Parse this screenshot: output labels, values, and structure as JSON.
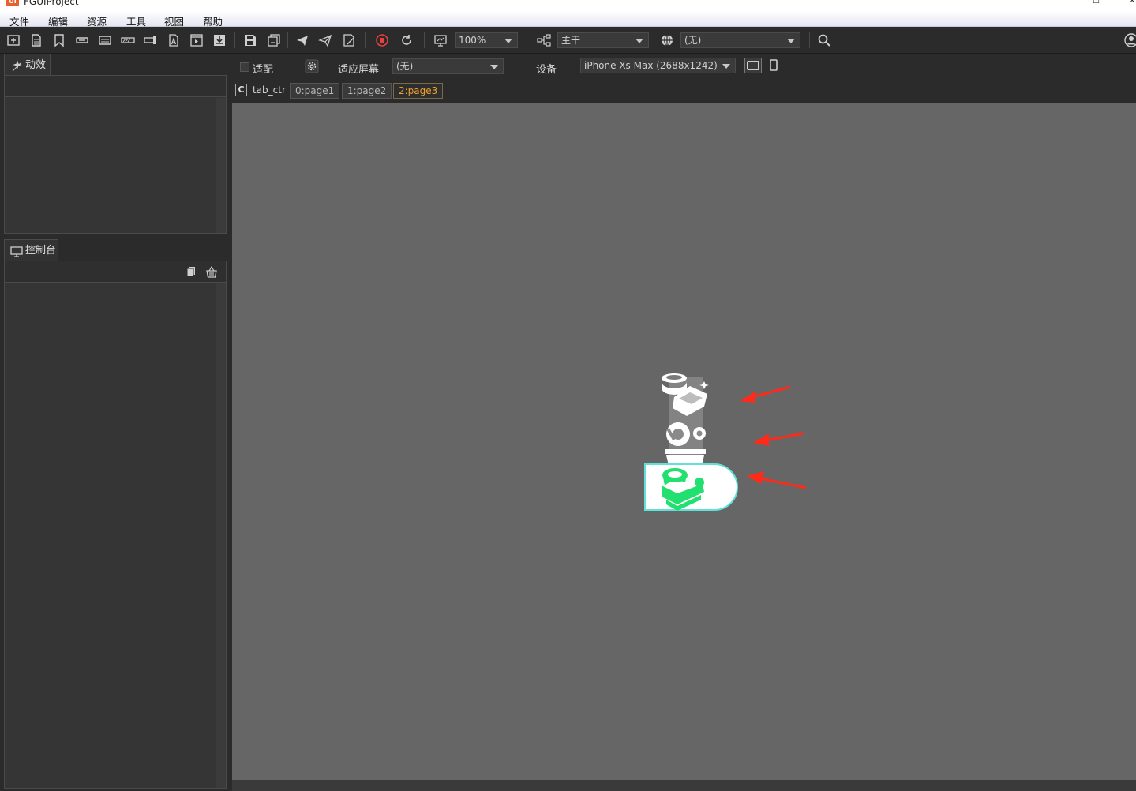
{
  "window": {
    "title": "FGUIProject",
    "logo_text": "UI"
  },
  "menu": {
    "items": [
      "文件",
      "编辑",
      "资源",
      "工具",
      "视图",
      "帮助"
    ]
  },
  "toolbar": {
    "zoom": "100%",
    "branch": "主干",
    "language": "(无)"
  },
  "panels": {
    "effects": {
      "label": "动效"
    },
    "console": {
      "label": "控制台"
    }
  },
  "options": {
    "fit_label": "适配",
    "fit_screen_label": "适应屏幕",
    "fit_screen_value": "(无)",
    "device_label": "设备",
    "device_value": "iPhone Xs Max (2688x1242)"
  },
  "controller": {
    "badge": "C",
    "name": "tab_ctr",
    "pages": [
      {
        "label": "0:page1",
        "active": false
      },
      {
        "label": "1:page2",
        "active": false
      },
      {
        "label": "2:page3",
        "active": true
      }
    ]
  },
  "colors": {
    "active_tab_accent": "#f0a030",
    "stage_background": "#666666",
    "selected_icon": "#22e070",
    "arrow_annotation": "#ff2a1a"
  }
}
